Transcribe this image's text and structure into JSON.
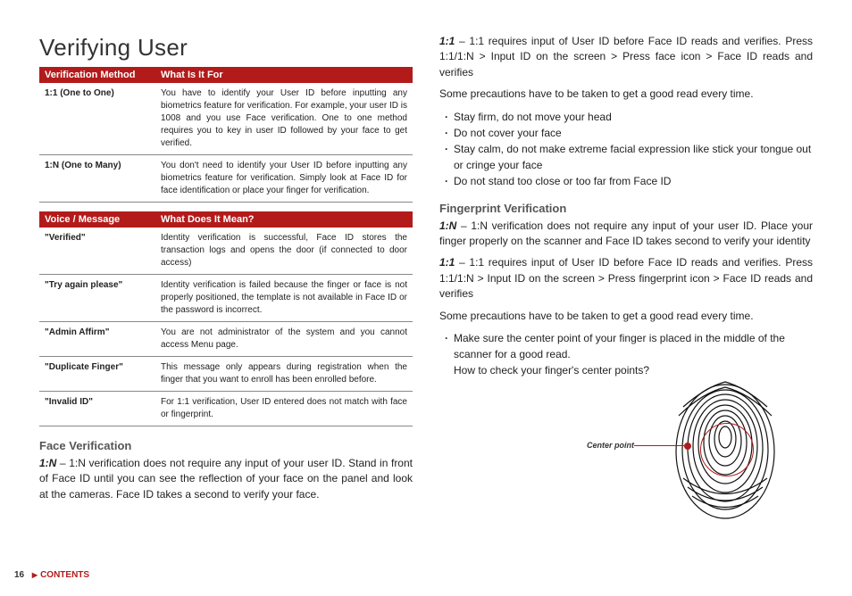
{
  "title": "Verifying User",
  "table1": {
    "head1": "Verification Method",
    "head2": "What Is It For",
    "rows": [
      {
        "k": "1:1 (One to One)",
        "v": "You have to identify your User ID before inputting any biometrics feature for verification. For example, your user ID is 1008 and you use Face verification. One to one method requires you to key in user ID followed by your face to get verified."
      },
      {
        "k": "1:N (One to Many)",
        "v": "You don't need to identify your User ID before inputting any biometrics feature for verification. Simply look at Face ID for face identification or place your finger for verification."
      }
    ]
  },
  "table2": {
    "head1": "Voice / Message",
    "head2": "What Does It Mean?",
    "rows": [
      {
        "k": "\"Verified\"",
        "v": "Identity verification is successful, Face ID stores the transaction logs and opens the door (if connected to door access)"
      },
      {
        "k": "\"Try again please\"",
        "v": "Identity verification is failed because the finger or face is not properly positioned, the template is not available in Face ID or the password is incorrect."
      },
      {
        "k": "\"Admin Affirm\"",
        "v": "You are not administrator of the system and you cannot access Menu page."
      },
      {
        "k": "\"Duplicate Finger\"",
        "v": "This message only appears during registration when the finger that you want to enroll has been enrolled before."
      },
      {
        "k": "\"Invalid ID\"",
        "v": "For 1:1 verification, User ID entered does not match with face or fingerprint."
      }
    ]
  },
  "face": {
    "heading": "Face Verification",
    "p1_lead": "1:N",
    "p1": " – 1:N verification does not require any input of your user ID. Stand in front of Face ID until you can see the reflection of your face on the panel and look at the cameras. Face ID takes a second to verify your face.",
    "p2_lead": "1:1",
    "p2": " – 1:1 requires input of User ID before Face ID reads and verifies. Press 1:1/1:N > Input ID on the screen > Press face icon > Face ID reads and verifies",
    "precautions": "Some precautions have to be taken to get a good read every time.",
    "bullets": [
      "Stay firm, do not move your head",
      "Do not cover your face",
      "Stay calm, do not make extreme facial expression like stick your tongue out or cringe your face",
      "Do not stand too close or too far from Face ID"
    ]
  },
  "fp": {
    "heading": "Fingerprint Verification",
    "p1_lead": "1:N",
    "p1": " – 1:N verification does not require any input of your user ID. Place your finger properly on the scanner and Face ID takes second to verify your identity",
    "p2_lead": "1:1",
    "p2": " – 1:1 requires input of User ID before Face ID reads and verifies. Press 1:1/1:N > Input ID on the screen > Press fingerprint icon > Face ID reads and verifies",
    "precautions": "Some precautions have to be taken to get a good read every time.",
    "bullet": "Make sure the center point of your finger is placed in the middle of the scanner for a good read.",
    "how": "How to check your finger's center points?",
    "center_label": "Center point"
  },
  "footer": {
    "page": "16",
    "contents": "CONTENTS"
  }
}
